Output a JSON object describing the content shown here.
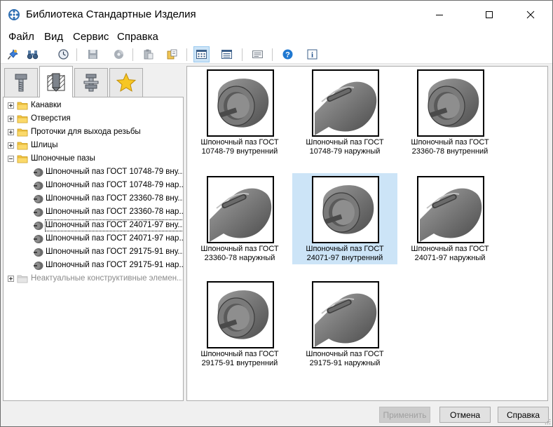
{
  "window": {
    "title": "Библиотека Стандартные Изделия"
  },
  "menu": {
    "items": [
      "Файл",
      "Вид",
      "Сервис",
      "Справка"
    ]
  },
  "toolbar": {
    "buttons": [
      "pin-icon",
      "binoculars-icon",
      "clock-icon",
      "save-icon",
      "disc-icon",
      "clipboard-icon",
      "paste-icon",
      "large-icons-view-icon",
      "list-view-icon",
      "details-view-icon",
      "help-icon",
      "info-icon"
    ],
    "active_view": "large-icons-view-icon"
  },
  "tabs": [
    "bolt-tab",
    "drill-hole-tab",
    "fastener-tab",
    "favorites-tab"
  ],
  "tree": {
    "items": [
      {
        "label": "Канавки",
        "type": "folder",
        "expanded": false
      },
      {
        "label": "Отверстия",
        "type": "folder",
        "expanded": false
      },
      {
        "label": "Проточки для выхода резьбы",
        "type": "folder",
        "expanded": false
      },
      {
        "label": "Шлицы",
        "type": "folder",
        "expanded": false
      },
      {
        "label": "Шпоночные пазы",
        "type": "folder",
        "expanded": true
      },
      {
        "label": "Шпоночный паз ГОСТ 10748-79 вну...",
        "type": "part"
      },
      {
        "label": "Шпоночный паз ГОСТ 10748-79 нар...",
        "type": "part"
      },
      {
        "label": "Шпоночный паз ГОСТ 23360-78 вну...",
        "type": "part"
      },
      {
        "label": "Шпоночный паз ГОСТ 23360-78 нар...",
        "type": "part"
      },
      {
        "label": "Шпоночный паз ГОСТ 24071-97 вну...",
        "type": "part",
        "selected": true
      },
      {
        "label": "Шпоночный паз ГОСТ 24071-97 нар...",
        "type": "part"
      },
      {
        "label": "Шпоночный паз ГОСТ 29175-91 вну...",
        "type": "part"
      },
      {
        "label": "Шпоночный паз ГОСТ 29175-91 нар...",
        "type": "part"
      },
      {
        "label": "Неактуальные конструктивные элемен...",
        "type": "folder",
        "expanded": false,
        "disabled": true
      }
    ]
  },
  "gallery": {
    "items": [
      {
        "line1": "Шпоночный паз ГОСТ",
        "line2": "10748-79 внутренний",
        "kind": "internal"
      },
      {
        "line1": "Шпоночный паз ГОСТ",
        "line2": "10748-79 наружный",
        "kind": "external"
      },
      {
        "line1": "Шпоночный паз ГОСТ",
        "line2": "23360-78 внутренний",
        "kind": "internal"
      },
      {
        "line1": "Шпоночный паз ГОСТ",
        "line2": "23360-78 наружный",
        "kind": "external"
      },
      {
        "line1": "Шпоночный паз ГОСТ",
        "line2": "24071-97 внутренний",
        "kind": "internal",
        "selected": true
      },
      {
        "line1": "Шпоночный паз ГОСТ",
        "line2": "24071-97 наружный",
        "kind": "external"
      },
      {
        "line1": "Шпоночный паз ГОСТ",
        "line2": "29175-91 внутренний",
        "kind": "internal"
      },
      {
        "line1": "Шпоночный паз ГОСТ",
        "line2": "29175-91 наружный",
        "kind": "external"
      }
    ]
  },
  "buttons": {
    "apply": "Применить",
    "cancel": "Отмена",
    "help": "Справка"
  },
  "colors": {
    "selection": "#cce4f7",
    "folder": "#f5c542",
    "part": "#6b6b6b"
  }
}
